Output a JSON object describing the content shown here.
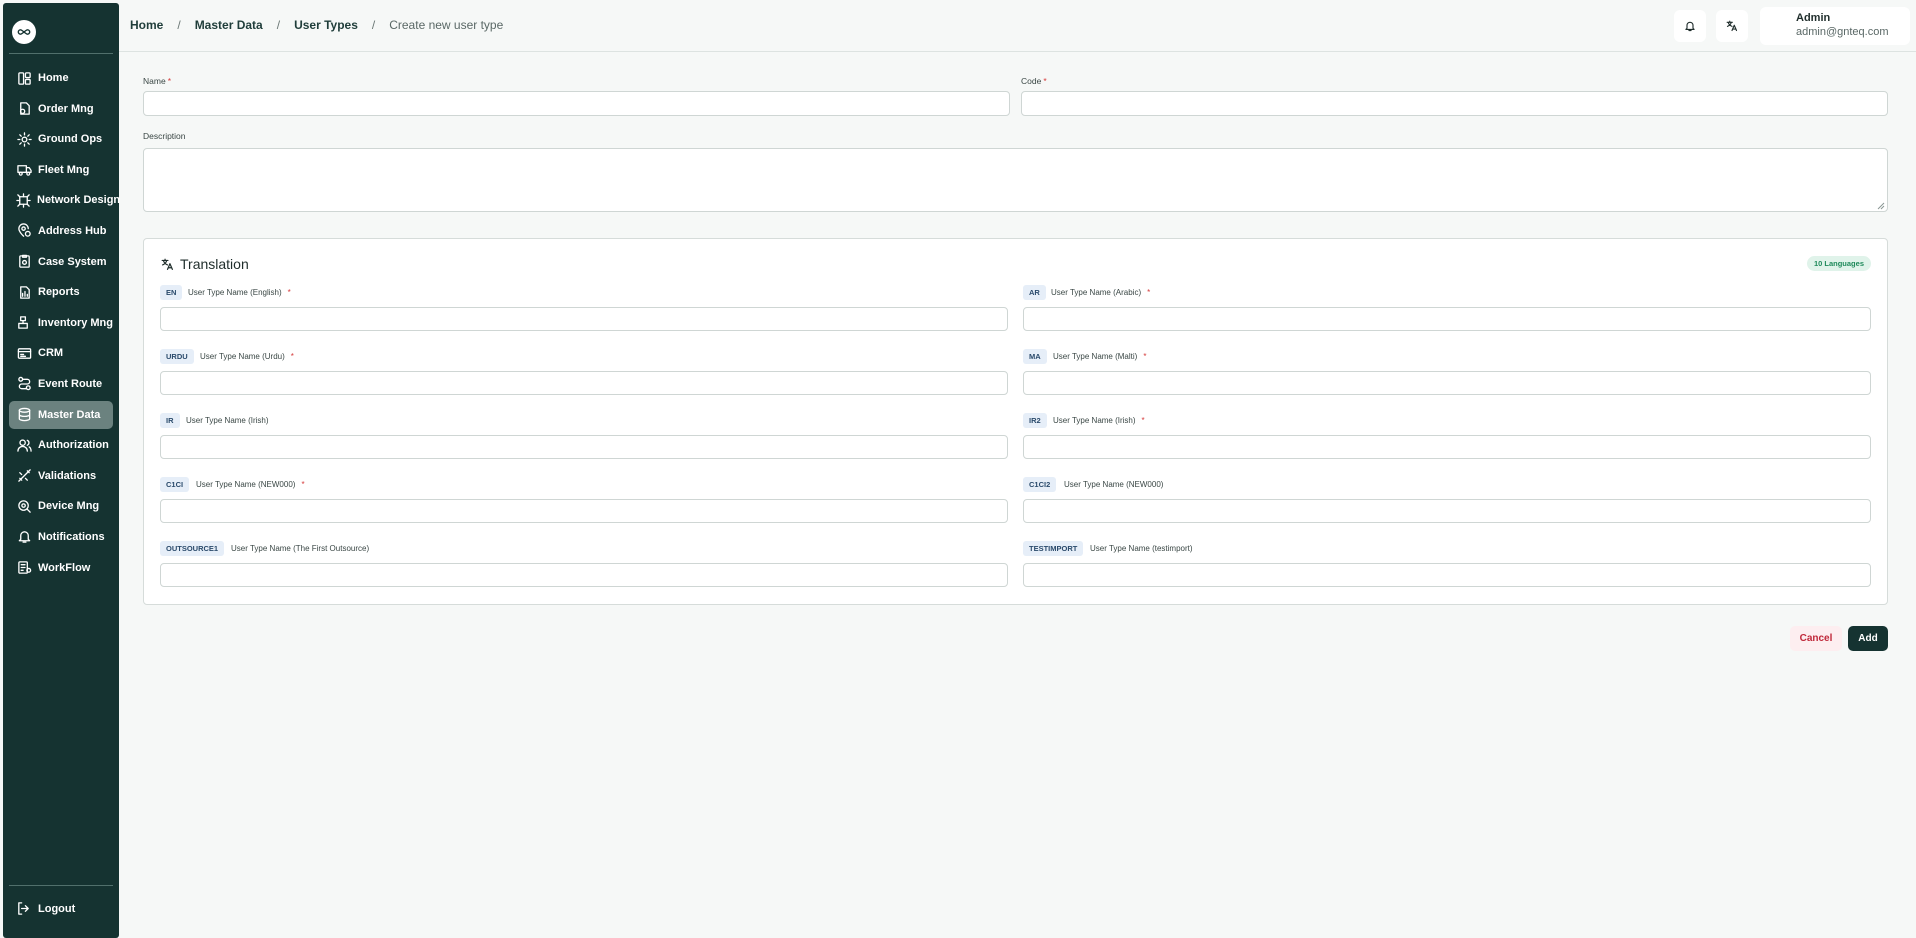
{
  "sidebar": {
    "items": [
      {
        "label": "Home",
        "icon": "home-icon"
      },
      {
        "label": "Order Mng",
        "icon": "order-icon"
      },
      {
        "label": "Ground Ops",
        "icon": "ground-ops-icon"
      },
      {
        "label": "Fleet Mng",
        "icon": "truck-icon"
      },
      {
        "label": "Network Design",
        "icon": "network-icon"
      },
      {
        "label": "Address Hub",
        "icon": "location-icon"
      },
      {
        "label": "Case System",
        "icon": "case-icon"
      },
      {
        "label": "Reports",
        "icon": "report-icon"
      },
      {
        "label": "Inventory Mng",
        "icon": "inventory-icon"
      },
      {
        "label": "CRM",
        "icon": "crm-icon"
      },
      {
        "label": "Event Route",
        "icon": "route-icon"
      },
      {
        "label": "Master Data",
        "icon": "database-icon",
        "active": true
      },
      {
        "label": "Authorization",
        "icon": "users-icon"
      },
      {
        "label": "Validations",
        "icon": "validation-icon"
      },
      {
        "label": "Device Mng",
        "icon": "device-icon"
      },
      {
        "label": "Notifications",
        "icon": "bell-icon"
      },
      {
        "label": "WorkFlow",
        "icon": "workflow-icon"
      }
    ],
    "logout_label": "Logout"
  },
  "breadcrumb": {
    "home": "Home",
    "master_data": "Master Data",
    "user_types": "User Types",
    "current": "Create new user type"
  },
  "user": {
    "name": "Admin",
    "email": "admin@gnteq.com"
  },
  "form": {
    "name_label": "Name",
    "code_label": "Code",
    "description_label": "Description",
    "name_value": "",
    "code_value": "",
    "description_value": ""
  },
  "translation": {
    "title": "Translation",
    "badge": "10 Languages",
    "fields": [
      {
        "code": "EN",
        "label": "User Type Name (English)",
        "required": true,
        "value": ""
      },
      {
        "code": "AR",
        "label": "User Type Name (Arabic)",
        "required": true,
        "value": ""
      },
      {
        "code": "URDU",
        "label": "User Type Name (Urdu)",
        "required": true,
        "value": ""
      },
      {
        "code": "MA",
        "label": "User Type Name (Malti)",
        "required": true,
        "value": ""
      },
      {
        "code": "IR",
        "label": "User Type Name (Irish)",
        "required": false,
        "value": ""
      },
      {
        "code": "IR2",
        "label": "User Type Name (Irish)",
        "required": true,
        "value": ""
      },
      {
        "code": "C1CI",
        "label": "User Type Name (NEW000)",
        "required": true,
        "value": ""
      },
      {
        "code": "C1CI2",
        "label": "User Type Name (NEW000)",
        "required": false,
        "value": ""
      },
      {
        "code": "OUTSOURCE1",
        "label": "User Type Name (The First Outsource)",
        "required": false,
        "value": ""
      },
      {
        "code": "TESTIMPORT",
        "label": "User Type Name (testimport)",
        "required": false,
        "value": ""
      }
    ]
  },
  "actions": {
    "cancel": "Cancel",
    "add": "Add"
  },
  "colors": {
    "sidebar": "#153331",
    "active_item": "#6b827f",
    "required": "#d63b3b",
    "badge_green": "#1f8a5b"
  }
}
